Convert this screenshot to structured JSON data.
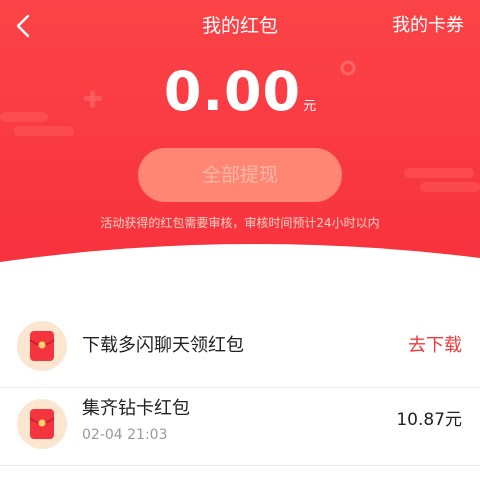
{
  "colors": {
    "accent": "#f23a3a",
    "hero_top": "#fc3f43",
    "hero_bottom": "#f8323f"
  },
  "nav": {
    "back_icon": "chevron-left-icon",
    "title": "我的红包",
    "right_label": "我的卡券"
  },
  "balance": {
    "amount": "0.00",
    "unit": "元"
  },
  "withdraw": {
    "label": "全部提现",
    "notice": "活动获得的红包需要审核，审核时间预计24小时以内"
  },
  "items": [
    {
      "icon": "red-envelope-icon",
      "title": "下载多闪聊天领红包",
      "action": "去下载"
    },
    {
      "icon": "red-envelope-icon",
      "title": "集齐钻卡红包",
      "date": "02-04 21:03",
      "value": "10.87元"
    }
  ]
}
